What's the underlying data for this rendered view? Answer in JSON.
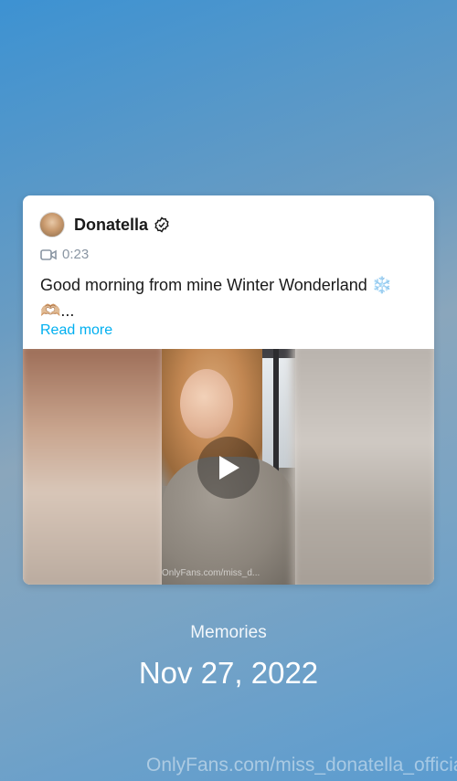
{
  "post": {
    "author_name": "Donatella",
    "duration": "0:23",
    "text": "Good morning from mine Winter Wonderland ❄️🫶🏼...",
    "read_more_label": "Read more",
    "media_watermark": "OnlyFans.com/miss_d..."
  },
  "memories_label": "Memories",
  "date": "Nov 27, 2022",
  "watermark": "OnlyFans.com/miss_donatella_official",
  "icons": {
    "verified": "verified-badge-icon",
    "video": "video-camera-icon",
    "play": "play-icon"
  },
  "colors": {
    "accent": "#00aff0",
    "muted_text": "#8a96a3"
  }
}
